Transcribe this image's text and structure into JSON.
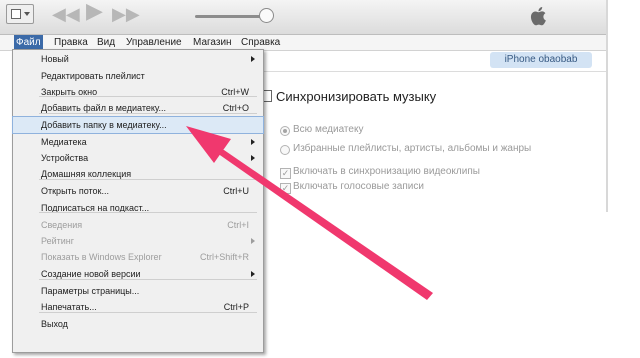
{
  "toolbar": {
    "system_menu_icon": "app-menu-icon",
    "prev_icon": "rewind-icon",
    "play_icon": "play-icon",
    "next_icon": "fast-forward-icon",
    "logo_icon": "apple-logo-icon",
    "prev_glyph": "◀◀",
    "play_glyph": "▶",
    "next_glyph": "▶▶",
    "volume_level": 0.9
  },
  "menubar": {
    "items": [
      "Файл",
      "Правка",
      "Вид",
      "Управление",
      "Магазин",
      "Справка"
    ]
  },
  "file_menu": {
    "items": [
      {
        "label": "Новый",
        "shortcut": "",
        "submenu": true,
        "disabled": false
      },
      {
        "label": "Редактировать плейлист",
        "shortcut": "",
        "submenu": false,
        "disabled": false
      },
      {
        "label": "Закрыть окно",
        "shortcut": "Ctrl+W",
        "submenu": false,
        "disabled": false
      },
      {
        "label": "Добавить файл в медиатеку...",
        "shortcut": "Ctrl+O",
        "submenu": false,
        "disabled": false
      },
      {
        "label": "Добавить папку в медиатеку...",
        "shortcut": "",
        "submenu": false,
        "disabled": false,
        "highlighted": true
      },
      {
        "label": "Медиатека",
        "shortcut": "",
        "submenu": true,
        "disabled": false
      },
      {
        "label": "Устройства",
        "shortcut": "",
        "submenu": true,
        "disabled": false
      },
      {
        "label": "Домашняя коллекция",
        "shortcut": "",
        "submenu": false,
        "disabled": false
      },
      {
        "label": "Открыть поток...",
        "shortcut": "Ctrl+U",
        "submenu": false,
        "disabled": false
      },
      {
        "label": "Подписаться на подкаст...",
        "shortcut": "",
        "submenu": false,
        "disabled": false
      },
      {
        "label": "Сведения",
        "shortcut": "Ctrl+I",
        "submenu": false,
        "disabled": true
      },
      {
        "label": "Рейтинг",
        "shortcut": "",
        "submenu": true,
        "disabled": true
      },
      {
        "label": "Показать в Windows Explorer",
        "shortcut": "Ctrl+Shift+R",
        "submenu": false,
        "disabled": true
      },
      {
        "label": "Создание новой версии",
        "shortcut": "",
        "submenu": true,
        "disabled": false
      },
      {
        "label": "Параметры страницы...",
        "shortcut": "",
        "submenu": false,
        "disabled": false
      },
      {
        "label": "Напечатать...",
        "shortcut": "Ctrl+P",
        "submenu": false,
        "disabled": false
      },
      {
        "label": "Выход",
        "shortcut": "",
        "submenu": false,
        "disabled": false
      }
    ]
  },
  "device": {
    "name": "iPhone obaobab"
  },
  "sync": {
    "title": "Синхронизировать музыку",
    "checked": false,
    "options": [
      {
        "label": "Всю медиатеку",
        "type": "radio",
        "selected": true
      },
      {
        "label": "Избранные плейлисты, артисты, альбомы и жанры",
        "type": "radio",
        "selected": false
      },
      {
        "label": "Включать в синхронизацию видеоклипы",
        "type": "checkbox",
        "checked": true
      },
      {
        "label": "Включать голосовые записи",
        "type": "checkbox",
        "checked": true
      }
    ]
  },
  "annotation": {
    "arrow_color": "#f0386e",
    "arrow_icon": "pointer-arrow-annotation"
  }
}
